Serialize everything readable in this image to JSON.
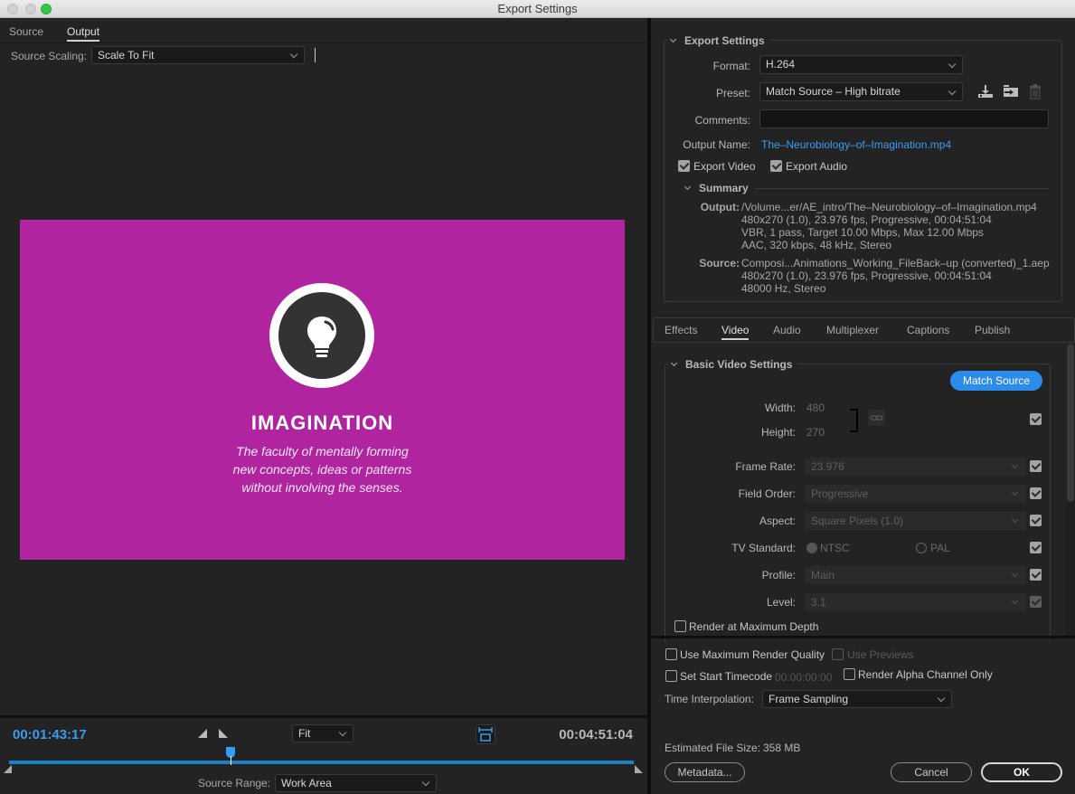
{
  "window": {
    "title": "Export Settings"
  },
  "left": {
    "tabs": [
      {
        "label": "Source",
        "active": false
      },
      {
        "label": "Output",
        "active": true
      }
    ],
    "source_scaling": {
      "label": "Source Scaling:",
      "value": "Scale To Fit"
    },
    "preview": {
      "background_color": "#b0249f",
      "icon": "lightbulb-icon",
      "title": "IMAGINATION",
      "description_lines": [
        "The faculty of mentally forming",
        "new concepts, ideas or patterns",
        "without involving the senses."
      ]
    },
    "timeline": {
      "current_timecode": "00:01:43:17",
      "total_timecode": "00:04:51:04",
      "zoom": "Fit",
      "playhead_fraction": 0.355,
      "source_range": {
        "label": "Source Range:",
        "value": "Work Area"
      }
    }
  },
  "export_settings": {
    "heading": "Export Settings",
    "format": {
      "label": "Format:",
      "value": "H.264"
    },
    "preset": {
      "label": "Preset:",
      "value": "Match Source – High bitrate"
    },
    "preset_icons": [
      "save-preset-icon",
      "import-preset-icon",
      "delete-preset-icon"
    ],
    "comments": {
      "label": "Comments:",
      "value": ""
    },
    "output_name": {
      "label": "Output Name:",
      "value": "The–Neurobiology–of–Imagination.mp4"
    },
    "export_video": {
      "label": "Export Video",
      "checked": true
    },
    "export_audio": {
      "label": "Export Audio",
      "checked": true
    },
    "summary": {
      "heading": "Summary",
      "output_key": "Output:",
      "output_lines": [
        "/Volume...er/AE_intro/The–Neurobiology–of–Imagination.mp4",
        "480x270 (1.0), 23.976 fps, Progressive, 00:04:51:04",
        "VBR, 1 pass, Target 10.00 Mbps, Max 12.00 Mbps",
        "AAC, 320 kbps, 48 kHz, Stereo"
      ],
      "source_key": "Source:",
      "source_lines": [
        "Composi...Animations_Working_FileBack–up (converted)_1.aep",
        "480x270 (1.0), 23.976 fps, Progressive, 00:04:51:04",
        "48000 Hz, Stereo"
      ]
    }
  },
  "settings_tabs": [
    {
      "label": "Effects",
      "active": false
    },
    {
      "label": "Video",
      "active": true
    },
    {
      "label": "Audio",
      "active": false
    },
    {
      "label": "Multiplexer",
      "active": false
    },
    {
      "label": "Captions",
      "active": false
    },
    {
      "label": "Publish",
      "active": false
    }
  ],
  "basic_video": {
    "heading": "Basic Video Settings",
    "match_source": "Match Source",
    "width": {
      "label": "Width:",
      "value": "480"
    },
    "height": {
      "label": "Height:",
      "value": "270"
    },
    "frame_rate": {
      "label": "Frame Rate:",
      "value": "23.976"
    },
    "field_order": {
      "label": "Field Order:",
      "value": "Progressive"
    },
    "aspect": {
      "label": "Aspect:",
      "value": "Square Pixels (1.0)"
    },
    "tv_standard": {
      "label": "TV Standard:",
      "options": [
        "NTSC",
        "PAL"
      ],
      "selected": "NTSC"
    },
    "profile": {
      "label": "Profile:",
      "value": "Main"
    },
    "level": {
      "label": "Level:",
      "value": "3.1"
    },
    "render_max_depth": {
      "label": "Render at Maximum Depth",
      "checked": false
    }
  },
  "bottom": {
    "use_max_render_quality": {
      "label": "Use Maximum Render Quality",
      "checked": false
    },
    "use_previews": {
      "label": "Use Previews",
      "checked": false,
      "disabled": true
    },
    "set_start_timecode": {
      "label": "Set Start Timecode",
      "checked": false,
      "value": "00:00:00:00"
    },
    "render_alpha_only": {
      "label": "Render Alpha Channel Only",
      "checked": false
    },
    "time_interpolation": {
      "label": "Time Interpolation:",
      "value": "Frame Sampling"
    },
    "estimated_file_size": {
      "label": "Estimated File Size:",
      "value": "358 MB"
    },
    "metadata_button": "Metadata...",
    "cancel_button": "Cancel",
    "ok_button": "OK"
  },
  "colors": {
    "accent": "#3a9cf0",
    "button_blue": "#2d8ceb",
    "panel": "#232323"
  }
}
